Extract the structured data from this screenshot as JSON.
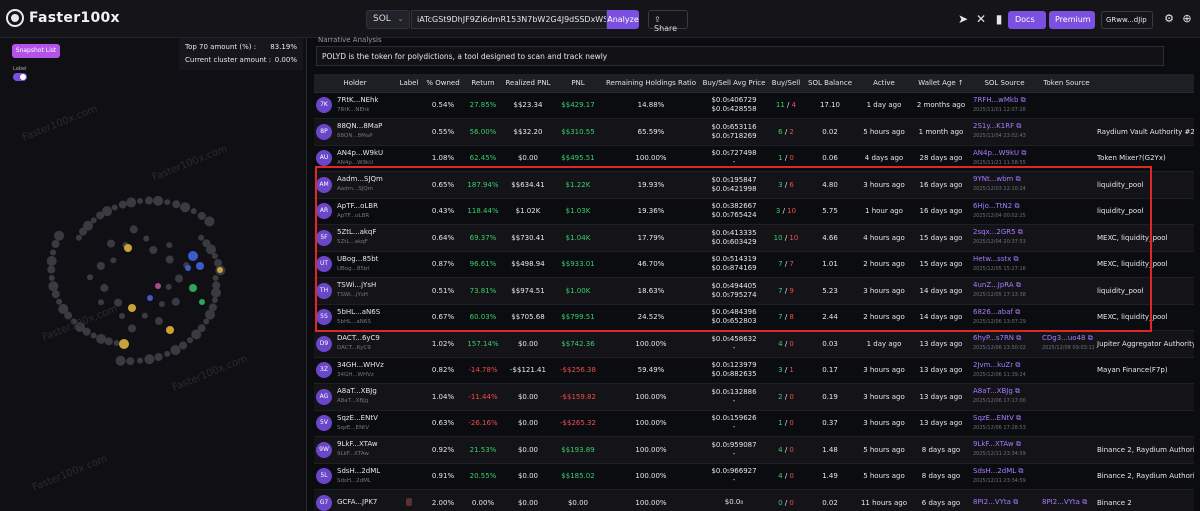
{
  "app": {
    "name": "Faster100x"
  },
  "topbar": {
    "chain": "SOL",
    "token_address": "iATcGSt9DhJF9Zi6dmR153N7bW2G4J9dSSDxWSpump",
    "analyze_label": "Analyze",
    "share_label": "Share",
    "docs_label": "Docs",
    "premium_label": "Premium",
    "user_label": "GRww...dJip"
  },
  "left": {
    "snapshot_label": "Snapshot List",
    "label_caption": "Label",
    "top_amount_key": "Top 70 amount (%) :",
    "top_amount_val": "83.19%",
    "cluster_key": "Current cluster amount :",
    "cluster_val": "0.00%",
    "watermark": "Faster100x.com"
  },
  "narrative": {
    "caption": "Narrative Analysis",
    "text": "POLYD is the token for polydictions, a tool designed to scan and track newly"
  },
  "table": {
    "headers": [
      "Holder",
      "Label",
      "% Owned",
      "Return",
      "Realized PNL",
      "PNL",
      "Remaining Holdings Ratio",
      "Buy/Sell Avg Price",
      "Buy/Sell",
      "SOL Balance",
      "Active",
      "Wallet Age ↑",
      "SOL Source",
      "Token Source",
      ""
    ],
    "rows": [
      {
        "av": "7K",
        "name": "7RtK...NEhk",
        "sub": "7RtK...NEhk",
        "owned": "0.54%",
        "ret": "27.85%",
        "ret_c": "g",
        "rpnl": "$$23.34",
        "rpnl_c": "",
        "pnl": "$$429.17",
        "pnl_c": "g",
        "ratio": "14.88%",
        "p1": "$0.0₅406729",
        "p2": "$0.0₅428558",
        "b": "11",
        "s": "4",
        "sol": "17.10",
        "active": "1 day ago",
        "age": "2 months ago",
        "src": "7RFH...wMkb",
        "src_d": "2025/11/01 12:07:28",
        "tsrc": "",
        "tsrc_d": "",
        "lbl": ""
      },
      {
        "av": "8P",
        "name": "88QN...8MaP",
        "sub": "88QN...8MaP",
        "owned": "0.55%",
        "ret": "56.00%",
        "ret_c": "g",
        "rpnl": "$$32.20",
        "rpnl_c": "",
        "pnl": "$$310.55",
        "pnl_c": "g",
        "ratio": "65.59%",
        "p1": "$0.0₅653116",
        "p2": "$0.0₅718269",
        "b": "6",
        "s": "2",
        "sol": "0.02",
        "active": "5 hours ago",
        "age": "1 month ago",
        "src": "2S1y...K1RF",
        "src_d": "2025/11/04 23:02:43",
        "tsrc": "",
        "tsrc_d": "",
        "lbl": "Raydium Vault Authority #2"
      },
      {
        "av": "AU",
        "name": "AN4p...W9kU",
        "sub": "AN4p...W9kU",
        "owned": "1.08%",
        "ret": "62.45%",
        "ret_c": "g",
        "rpnl": "$0.00",
        "rpnl_c": "",
        "pnl": "$$495.51",
        "pnl_c": "g",
        "ratio": "100.00%",
        "p1": "$0.0₅727498",
        "p2": "-",
        "b": "1",
        "s": "0",
        "sol": "0.06",
        "active": "4 days ago",
        "age": "28 days ago",
        "src": "AN4p...W9kU",
        "src_d": "2025/11/21 11:58:55",
        "tsrc": "",
        "tsrc_d": "",
        "lbl": "Token Mixer?(G2Yx)"
      },
      {
        "av": "AM",
        "name": "Aadm...SJQm",
        "sub": "Aadm...SJQm",
        "owned": "0.65%",
        "ret": "187.94%",
        "ret_c": "g",
        "rpnl": "$$634.41",
        "rpnl_c": "",
        "pnl": "$1.22K",
        "pnl_c": "g",
        "ratio": "19.93%",
        "p1": "$0.0₅195847",
        "p2": "$0.0₅421998",
        "b": "3",
        "s": "6",
        "sol": "4.80",
        "active": "3 hours ago",
        "age": "16 days ago",
        "src": "9YNt...wbm",
        "src_d": "2025/12/03 22:10:24",
        "tsrc": "",
        "tsrc_d": "",
        "lbl": "liquidity_pool"
      },
      {
        "av": "AR",
        "name": "ApTF...oLBR",
        "sub": "ApTF...oLBR",
        "owned": "0.43%",
        "ret": "118.44%",
        "ret_c": "g",
        "rpnl": "$1.02K",
        "rpnl_c": "",
        "pnl": "$1.03K",
        "pnl_c": "g",
        "ratio": "19.36%",
        "p1": "$0.0₅382667",
        "p2": "$0.0₅765424",
        "b": "3",
        "s": "10",
        "sol": "5.75",
        "active": "1 hour ago",
        "age": "16 days ago",
        "src": "6Hjo...TtN2",
        "src_d": "2025/12/04 00:02:25",
        "tsrc": "",
        "tsrc_d": "",
        "lbl": "liquidity_pool"
      },
      {
        "av": "5F",
        "name": "5ZtL...akqF",
        "sub": "5ZtL...akqF",
        "owned": "0.64%",
        "ret": "69.37%",
        "ret_c": "g",
        "rpnl": "$$730.41",
        "rpnl_c": "",
        "pnl": "$1.04K",
        "pnl_c": "g",
        "ratio": "17.79%",
        "p1": "$0.0₅413335",
        "p2": "$0.0₅603429",
        "b": "10",
        "s": "10",
        "sol": "4.66",
        "active": "4 hours ago",
        "age": "15 days ago",
        "src": "2sqx...2GR5",
        "src_d": "2025/12/04 20:37:53",
        "tsrc": "",
        "tsrc_d": "",
        "lbl": "MEXC, liquidity_pool"
      },
      {
        "av": "UT",
        "name": "UBog...85bt",
        "sub": "UBog...85bt",
        "owned": "0.87%",
        "ret": "96.61%",
        "ret_c": "g",
        "rpnl": "$$498.94",
        "rpnl_c": "",
        "pnl": "$$933.01",
        "pnl_c": "g",
        "ratio": "46.70%",
        "p1": "$0.0₅514319",
        "p2": "$0.0₅874169",
        "b": "7",
        "s": "7",
        "sol": "1.01",
        "active": "2 hours ago",
        "age": "15 days ago",
        "src": "Hetw...sstx",
        "src_d": "2025/12/05 15:27:16",
        "tsrc": "",
        "tsrc_d": "",
        "lbl": "MEXC, liquidity_pool"
      },
      {
        "av": "TH",
        "name": "TSWi...jYsH",
        "sub": "TSWi...jYsH",
        "owned": "0.51%",
        "ret": "73.81%",
        "ret_c": "g",
        "rpnl": "$$974.51",
        "rpnl_c": "",
        "pnl": "$1.00K",
        "pnl_c": "g",
        "ratio": "18.63%",
        "p1": "$0.0₅494405",
        "p2": "$0.0₅795274",
        "b": "7",
        "s": "9",
        "sol": "5.23",
        "active": "3 hours ago",
        "age": "14 days ago",
        "src": "4unZ...JpRA",
        "src_d": "2025/12/05 17:13:38",
        "tsrc": "",
        "tsrc_d": "",
        "lbl": "liquidity_pool"
      },
      {
        "av": "5S",
        "name": "5bHL...aN6S",
        "sub": "5bHL...aN6S",
        "owned": "0.67%",
        "ret": "60.03%",
        "ret_c": "g",
        "rpnl": "$$705.68",
        "rpnl_c": "",
        "pnl": "$$799.51",
        "pnl_c": "g",
        "ratio": "24.52%",
        "p1": "$0.0₅484396",
        "p2": "$0.0₅652803",
        "b": "7",
        "s": "8",
        "sol": "2.44",
        "active": "2 hours ago",
        "age": "14 days ago",
        "src": "6826...abaf",
        "src_d": "2025/12/06 13:07:29",
        "tsrc": "",
        "tsrc_d": "",
        "lbl": "MEXC, liquidity_pool"
      },
      {
        "av": "D9",
        "name": "DACT...6yC9",
        "sub": "DACT...6yC9",
        "owned": "1.02%",
        "ret": "157.14%",
        "ret_c": "g",
        "rpnl": "$0.00",
        "rpnl_c": "",
        "pnl": "$$742.36",
        "pnl_c": "g",
        "ratio": "100.00%",
        "p1": "$0.0₅458632",
        "p2": "-",
        "b": "4",
        "s": "0",
        "sol": "0.03",
        "active": "1 day ago",
        "age": "13 days ago",
        "src": "6hyP...s7RN",
        "src_d": "2025/12/06 13:50:02",
        "tsrc": "CDg3...uo48",
        "tsrc_d": "2025/12/08 09:03:11",
        "lbl": "Jupiter Aggregator Authority 3, Jupiter"
      },
      {
        "av": "3Z",
        "name": "34GH...WHVz",
        "sub": "34GH...WHVz",
        "owned": "0.82%",
        "ret": "-14.78%",
        "ret_c": "r",
        "rpnl": "-$$121.41",
        "rpnl_c": "",
        "pnl": "-$$256.38",
        "pnl_c": "r",
        "ratio": "59.49%",
        "p1": "$0.0₅123979",
        "p2": "$0.0₅882635",
        "b": "3",
        "s": "1",
        "sol": "0.17",
        "active": "3 hours ago",
        "age": "13 days ago",
        "src": "2Jvm...kuZr",
        "src_d": "2025/12/06 11:39:24",
        "tsrc": "",
        "tsrc_d": "",
        "lbl": "Mayan Finance(F7p)"
      },
      {
        "av": "AG",
        "name": "A8aT...XBJg",
        "sub": "A8aT...XBJg",
        "owned": "1.04%",
        "ret": "-11.44%",
        "ret_c": "r",
        "rpnl": "$0.00",
        "rpnl_c": "",
        "pnl": "-$$159.82",
        "pnl_c": "r",
        "ratio": "100.00%",
        "p1": "$0.0₅132886",
        "p2": "-",
        "b": "2",
        "s": "0",
        "sol": "0.19",
        "active": "3 hours ago",
        "age": "13 days ago",
        "src": "A8aT...XBJg",
        "src_d": "2025/12/06 17:17:00",
        "tsrc": "",
        "tsrc_d": "",
        "lbl": ""
      },
      {
        "av": "5V",
        "name": "SqzE...ENtV",
        "sub": "SqzE...ENtV",
        "owned": "0.63%",
        "ret": "-26.16%",
        "ret_c": "r",
        "rpnl": "$0.00",
        "rpnl_c": "",
        "pnl": "-$$265.32",
        "pnl_c": "r",
        "ratio": "100.00%",
        "p1": "$0.0₅159626",
        "p2": "-",
        "b": "1",
        "s": "0",
        "sol": "0.37",
        "active": "3 hours ago",
        "age": "13 days ago",
        "src": "SqzE...ENtV",
        "src_d": "2025/12/06 17:28:53",
        "tsrc": "",
        "tsrc_d": "",
        "lbl": ""
      },
      {
        "av": "9W",
        "name": "9LkF...XTAw",
        "sub": "9LkF...XTAw",
        "owned": "0.92%",
        "ret": "21.53%",
        "ret_c": "g",
        "rpnl": "$0.00",
        "rpnl_c": "",
        "pnl": "$$193.89",
        "pnl_c": "g",
        "ratio": "100.00%",
        "p1": "$0.0₅959087",
        "p2": "-",
        "b": "4",
        "s": "0",
        "sol": "1.48",
        "active": "5 hours ago",
        "age": "8 days ago",
        "src": "9LkF...XTAw",
        "src_d": "2025/12/11 23:34:59",
        "tsrc": "",
        "tsrc_d": "",
        "lbl": "Binance 2, Raydium Authority V4"
      },
      {
        "av": "5L",
        "name": "SdsH...2dML",
        "sub": "SdsH...2dML",
        "owned": "0.91%",
        "ret": "20.55%",
        "ret_c": "g",
        "rpnl": "$0.00",
        "rpnl_c": "",
        "pnl": "$$185.02",
        "pnl_c": "g",
        "ratio": "100.00%",
        "p1": "$0.0₅966927",
        "p2": "-",
        "b": "4",
        "s": "0",
        "sol": "1.49",
        "active": "5 hours ago",
        "age": "8 days ago",
        "src": "SdsH...2dML",
        "src_d": "2025/12/11 23:34:59",
        "tsrc": "",
        "tsrc_d": "",
        "lbl": "Binance 2, Raydium Authority V4"
      },
      {
        "av": "G7",
        "name": "GCFA...JPK7",
        "sub": "",
        "owned": "2.00%",
        "ret": "0.00%",
        "ret_c": "",
        "rpnl": "$0.00",
        "rpnl_c": "",
        "pnl": "$0.00",
        "pnl_c": "",
        "ratio": "100.00%",
        "p1": "$0.0₀",
        "p2": "",
        "b": "0",
        "s": "0",
        "sol": "0.02",
        "active": "11 hours ago",
        "age": "6 days ago",
        "src": "8PI2...VYta",
        "src_d": "",
        "tsrc": "8PI2...VYta",
        "tsrc_d": "",
        "lbl": "Binance 2"
      }
    ]
  },
  "colors": {
    "accent": "#7b4fe0",
    "highlight": "#e02626",
    "positive": "#38d06a",
    "negative": "#f04d4d"
  }
}
